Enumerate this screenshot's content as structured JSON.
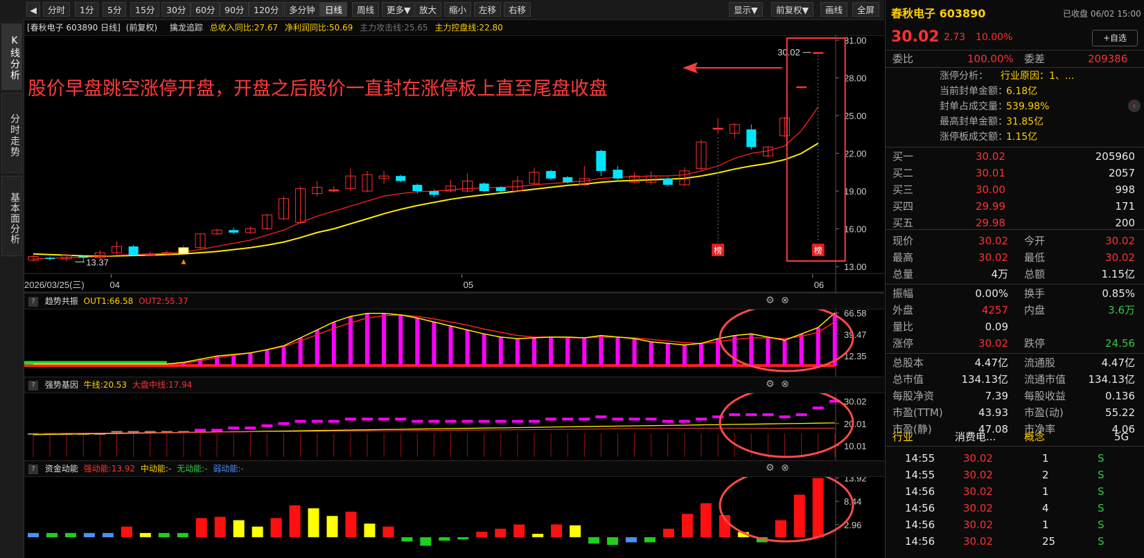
{
  "toolbar": {
    "nav_icon": "◀",
    "periods": [
      "分时",
      "1分",
      "5分",
      "15分",
      "30分",
      "60分",
      "90分",
      "120分",
      "多分钟",
      "日线",
      "周线",
      "更多▼"
    ],
    "actions": [
      "放大",
      "缩小",
      "左移",
      "右移"
    ],
    "right": [
      "显示▼",
      "前复权▼",
      "画线",
      "全屏"
    ]
  },
  "side_tabs": [
    "K线分析",
    "分时走势",
    "基本面分析"
  ],
  "main_header": {
    "title": "[春秋电子 603890 日线]",
    "fq": "(前复权)",
    "indicator": "擒龙追踪",
    "metric1": "总收入同比:27.67",
    "metric2": "净利润同比:50.69",
    "metric3": "主力攻击线:25.65",
    "metric4": "主力控盘线:22.80"
  },
  "annotation_text": "股价早盘跳空涨停开盘，开盘之后股价一直封在涨停板上直至尾盘收盘",
  "price_axis": [
    "31.00",
    "28.00",
    "25.00",
    "22.00",
    "19.00",
    "16.00",
    "13.00"
  ],
  "low_label": "13.37",
  "high_label": "30.02",
  "bang_label": "榜",
  "date_axis": {
    "start": "2026/03/25(三)",
    "m1": "04",
    "m2": "05",
    "m3": "06"
  },
  "panel1": {
    "name": "趋势共振",
    "out1": "OUT1:66.58",
    "out2": "OUT2:55.37",
    "axis": [
      "66.58",
      "39.47",
      "12.35"
    ]
  },
  "panel2": {
    "name": "强势基因",
    "l1": "牛线:20.53",
    "l2": "大盘中线:17.94",
    "axis": [
      "30.02",
      "20.01",
      "10.01"
    ]
  },
  "panel3": {
    "name": "资金动能",
    "l1": "强动能:13.92",
    "l2": "中动能:-",
    "l3": "无动能:-",
    "l4": "弱动能:-",
    "axis": [
      "13.92",
      "8.44",
      "2.96"
    ]
  },
  "colors": {
    "up": "#ff3030",
    "down": "#00e5ff",
    "ma1": "#ff2020",
    "ma2": "#ffee00",
    "magenta": "#ff00ff",
    "annot": "#ff3b3b"
  },
  "candles": [
    {
      "o": 13.5,
      "c": 13.8,
      "h": 13.9,
      "l": 13.4
    },
    {
      "o": 13.7,
      "c": 13.6,
      "h": 13.8,
      "l": 13.5
    },
    {
      "o": 13.6,
      "c": 13.9,
      "h": 14.0,
      "l": 13.4
    },
    {
      "o": 13.8,
      "c": 13.7,
      "h": 13.9,
      "l": 13.37
    },
    {
      "o": 13.7,
      "c": 14.1,
      "h": 14.3,
      "l": 13.6
    },
    {
      "o": 14.1,
      "c": 14.6,
      "h": 15.0,
      "l": 14.0
    },
    {
      "o": 14.6,
      "c": 13.9,
      "h": 14.7,
      "l": 13.8
    },
    {
      "o": 13.9,
      "c": 14.0,
      "h": 14.2,
      "l": 13.8
    },
    {
      "o": 14.0,
      "c": 14.1,
      "h": 14.3,
      "l": 13.9
    },
    {
      "o": 14.0,
      "c": 14.5,
      "h": 14.7,
      "l": 13.9
    },
    {
      "o": 14.5,
      "c": 15.6,
      "h": 15.6,
      "l": 14.4
    },
    {
      "o": 15.6,
      "c": 15.9,
      "h": 16.0,
      "l": 15.5
    },
    {
      "o": 15.9,
      "c": 15.7,
      "h": 16.1,
      "l": 15.6
    },
    {
      "o": 15.7,
      "c": 16.0,
      "h": 16.2,
      "l": 15.6
    },
    {
      "o": 16.0,
      "c": 17.1,
      "h": 17.2,
      "l": 15.9
    },
    {
      "o": 16.8,
      "c": 18.4,
      "h": 18.6,
      "l": 16.7
    },
    {
      "o": 16.5,
      "c": 19.2,
      "h": 19.4,
      "l": 16.4
    },
    {
      "o": 18.8,
      "c": 19.3,
      "h": 19.8,
      "l": 18.6
    },
    {
      "o": 19.0,
      "c": 19.1,
      "h": 19.4,
      "l": 18.9
    },
    {
      "o": 19.2,
      "c": 20.2,
      "h": 20.8,
      "l": 19.0
    },
    {
      "o": 19.0,
      "c": 20.3,
      "h": 20.6,
      "l": 18.9
    },
    {
      "o": 20.0,
      "c": 20.2,
      "h": 20.6,
      "l": 19.6
    },
    {
      "o": 20.2,
      "c": 19.8,
      "h": 20.3,
      "l": 19.7
    },
    {
      "o": 19.5,
      "c": 19.0,
      "h": 19.6,
      "l": 18.8
    },
    {
      "o": 19.0,
      "c": 18.7,
      "h": 19.1,
      "l": 18.5
    },
    {
      "o": 19.0,
      "c": 19.4,
      "h": 19.9,
      "l": 18.9
    },
    {
      "o": 19.0,
      "c": 19.8,
      "h": 20.4,
      "l": 18.9
    },
    {
      "o": 19.6,
      "c": 19.0,
      "h": 19.7,
      "l": 18.9
    },
    {
      "o": 19.3,
      "c": 19.0,
      "h": 19.4,
      "l": 18.9
    },
    {
      "o": 19.0,
      "c": 19.8,
      "h": 20.2,
      "l": 18.9
    },
    {
      "o": 19.6,
      "c": 20.5,
      "h": 20.8,
      "l": 19.5
    },
    {
      "o": 20.6,
      "c": 20.0,
      "h": 20.7,
      "l": 19.9
    },
    {
      "o": 20.1,
      "c": 19.7,
      "h": 20.2,
      "l": 19.6
    },
    {
      "o": 19.5,
      "c": 20.0,
      "h": 21.0,
      "l": 19.4
    },
    {
      "o": 22.2,
      "c": 20.6,
      "h": 22.3,
      "l": 20.2
    },
    {
      "o": 20.7,
      "c": 20.0,
      "h": 21.0,
      "l": 19.9
    },
    {
      "o": 19.7,
      "c": 20.2,
      "h": 20.5,
      "l": 19.6
    },
    {
      "o": 19.7,
      "c": 20.2,
      "h": 20.6,
      "l": 19.5
    },
    {
      "o": 20.0,
      "c": 19.5,
      "h": 20.1,
      "l": 19.4
    },
    {
      "o": 19.5,
      "c": 20.6,
      "h": 20.9,
      "l": 19.4
    },
    {
      "o": 20.8,
      "c": 22.9,
      "h": 23.1,
      "l": 20.6
    },
    {
      "o": 24.0,
      "c": 24.0,
      "h": 24.8,
      "l": 23.5
    },
    {
      "o": 23.6,
      "c": 24.3,
      "h": 24.4,
      "l": 23.2
    },
    {
      "o": 23.9,
      "c": 22.5,
      "h": 24.3,
      "l": 22.3
    },
    {
      "o": 21.8,
      "c": 22.5,
      "h": 22.6,
      "l": 21.7
    },
    {
      "o": 23.4,
      "c": 24.8,
      "h": 24.9,
      "l": 23.3
    },
    {
      "o": 27.3,
      "c": 27.3,
      "h": 27.3,
      "l": 27.3
    },
    {
      "o": 30.02,
      "c": 30.02,
      "h": 30.02,
      "l": 30.02
    }
  ],
  "ma1": [
    13.6,
    13.65,
    13.7,
    13.72,
    13.8,
    13.9,
    13.95,
    14.0,
    14.05,
    14.15,
    14.35,
    14.6,
    14.85,
    15.1,
    15.5,
    15.9,
    16.5,
    17.0,
    17.4,
    17.8,
    18.2,
    18.6,
    18.8,
    18.95,
    19.0,
    19.1,
    19.2,
    19.25,
    19.3,
    19.35,
    19.5,
    19.6,
    19.7,
    19.8,
    20.0,
    20.1,
    20.15,
    20.2,
    20.2,
    20.3,
    20.6,
    21.0,
    21.6,
    22.0,
    22.2,
    22.6,
    23.8,
    25.7
  ],
  "ma2": [
    14.0,
    13.95,
    13.9,
    13.85,
    13.82,
    13.85,
    13.88,
    13.9,
    13.95,
    14.0,
    14.1,
    14.2,
    14.35,
    14.5,
    14.7,
    14.95,
    15.3,
    15.7,
    16.0,
    16.4,
    16.8,
    17.2,
    17.55,
    17.85,
    18.1,
    18.35,
    18.55,
    18.7,
    18.85,
    19.0,
    19.15,
    19.3,
    19.45,
    19.55,
    19.7,
    19.8,
    19.85,
    19.9,
    19.95,
    20.0,
    20.2,
    20.45,
    20.75,
    21.0,
    21.2,
    21.5,
    22.0,
    22.8
  ],
  "p1_bars": [
    0,
    0,
    0,
    0,
    0,
    0,
    0,
    0,
    0,
    4,
    8,
    12,
    14,
    16,
    20,
    25,
    35,
    45,
    55,
    62,
    66,
    66,
    64,
    60,
    55,
    50,
    45,
    40,
    36,
    34,
    35,
    36,
    36,
    35,
    38,
    36,
    34,
    30,
    28,
    26,
    28,
    34,
    38,
    40,
    36,
    32,
    40,
    48,
    66.58
  ],
  "p1_red": [
    2,
    2,
    2,
    2,
    2,
    2,
    2,
    2,
    2,
    3,
    6,
    10,
    13,
    16,
    20,
    24,
    31,
    39,
    47,
    54,
    60,
    63,
    64,
    62,
    59,
    55,
    51,
    46,
    42,
    38,
    36,
    36,
    35,
    35,
    36,
    36,
    35,
    33,
    31,
    29,
    28,
    30,
    33,
    35,
    35,
    34,
    37,
    42,
    55.37
  ],
  "p1_yel": [
    2,
    2,
    2,
    2,
    2,
    2,
    2,
    2,
    2,
    4,
    8,
    12,
    14,
    16,
    20,
    25,
    35,
    45,
    55,
    62,
    66,
    66,
    64,
    60,
    55,
    50,
    45,
    40,
    36,
    34,
    35,
    36,
    36,
    35,
    38,
    36,
    34,
    30,
    28,
    26,
    28,
    34,
    38,
    40,
    36,
    32,
    40,
    48,
    66.58
  ],
  "p2_bars": [
    15,
    15,
    15,
    15,
    15,
    16,
    16,
    16,
    16,
    16,
    17,
    17,
    18,
    18,
    19,
    20,
    21,
    21,
    21,
    22,
    22,
    22,
    22,
    21,
    21,
    21,
    21,
    21,
    21,
    21,
    21,
    22,
    22,
    22,
    23,
    22,
    22,
    22,
    21,
    21,
    22,
    23,
    24,
    24,
    24,
    23,
    24,
    27,
    30.02
  ],
  "p3_vals": [
    {
      "v": 1.0,
      "t": "b"
    },
    {
      "v": 1.0,
      "t": "g"
    },
    {
      "v": 1.0,
      "t": "g"
    },
    {
      "v": 1.0,
      "t": "b"
    },
    {
      "v": 1.0,
      "t": "b"
    },
    {
      "v": 2.5,
      "t": "r"
    },
    {
      "v": 1.0,
      "t": "y"
    },
    {
      "v": 1.0,
      "t": "g"
    },
    {
      "v": 1.0,
      "t": "g"
    },
    {
      "v": 4.5,
      "t": "r"
    },
    {
      "v": 4.8,
      "t": "r"
    },
    {
      "v": 4.0,
      "t": "y"
    },
    {
      "v": 2.5,
      "t": "y"
    },
    {
      "v": 4.5,
      "t": "r"
    },
    {
      "v": 7.5,
      "t": "r"
    },
    {
      "v": 6.8,
      "t": "y"
    },
    {
      "v": 5.0,
      "t": "y"
    },
    {
      "v": 6.0,
      "t": "r"
    },
    {
      "v": 3.2,
      "t": "y"
    },
    {
      "v": 2.5,
      "t": "r"
    },
    {
      "v": -1.0,
      "t": "g"
    },
    {
      "v": -2.0,
      "t": "g"
    },
    {
      "v": -0.8,
      "t": "g"
    },
    {
      "v": -0.5,
      "t": "g"
    },
    {
      "v": 1.3,
      "t": "r"
    },
    {
      "v": 2.0,
      "t": "r"
    },
    {
      "v": 3.0,
      "t": "r"
    },
    {
      "v": 0.8,
      "t": "y"
    },
    {
      "v": 3.0,
      "t": "r"
    },
    {
      "v": 2.8,
      "t": "y"
    },
    {
      "v": -1.5,
      "t": "g"
    },
    {
      "v": -1.8,
      "t": "g"
    },
    {
      "v": -1.2,
      "t": "b"
    },
    {
      "v": -1.2,
      "t": "g"
    },
    {
      "v": 2.0,
      "t": "r"
    },
    {
      "v": 5.5,
      "t": "r"
    },
    {
      "v": 8.0,
      "t": "r"
    },
    {
      "v": 5.2,
      "t": "r"
    },
    {
      "v": 1.2,
      "t": "y"
    },
    {
      "v": -1.2,
      "t": "g"
    },
    {
      "v": 4.0,
      "t": "r"
    },
    {
      "v": 10.0,
      "t": "r"
    },
    {
      "v": 13.92,
      "t": "r"
    }
  ],
  "right": {
    "stock": "春秋电子 603890",
    "status": "已收盘 06/02 15:00",
    "price": "30.02",
    "change": "2.73",
    "pct": "10.00%",
    "watch": "+自选",
    "weibi_l": "委比",
    "weibi": "100.00%",
    "weicha_l": "委差",
    "weicha": "209386",
    "limit_title": "涨停分析：",
    "limit_reason": "行业原因：1、...",
    "seal_amt_l": "当前封单金额：",
    "seal_amt": "6.18亿",
    "seal_ratio_l": "封单占成交量：",
    "seal_ratio": "539.98%",
    "max_seal_l": "最高封单金额：",
    "max_seal": "31.85亿",
    "limit_vol_l": "涨停板成交额：",
    "limit_vol": "1.15亿",
    "buys": [
      {
        "l": "买一",
        "p": "30.02",
        "v": "205960"
      },
      {
        "l": "买二",
        "p": "30.01",
        "v": "2057"
      },
      {
        "l": "买三",
        "p": "30.00",
        "v": "998"
      },
      {
        "l": "买四",
        "p": "29.99",
        "v": "171"
      },
      {
        "l": "买五",
        "p": "29.98",
        "v": "200"
      }
    ],
    "stats": [
      {
        "a": "现价",
        "av": "30.02",
        "ac": "red",
        "b": "今开",
        "bv": "30.02",
        "bc": "red"
      },
      {
        "a": "最高",
        "av": "30.02",
        "ac": "red",
        "b": "最低",
        "bv": "30.02",
        "bc": "red"
      },
      {
        "a": "总量",
        "av": "4万",
        "ac": "white",
        "b": "总额",
        "bv": "1.15亿",
        "bc": "white"
      },
      {
        "a": "振幅",
        "av": "0.00%",
        "ac": "white",
        "b": "换手",
        "bv": "0.85%",
        "bc": "white"
      },
      {
        "a": "外盘",
        "av": "4257",
        "ac": "red",
        "b": "内盘",
        "bv": "3.6万",
        "bc": "green"
      },
      {
        "a": "量比",
        "av": "0.09",
        "ac": "white",
        "b": "",
        "bv": "",
        "bc": "white"
      },
      {
        "a": "涨停",
        "av": "30.02",
        "ac": "red",
        "b": "跌停",
        "bv": "24.56",
        "bc": "green"
      },
      {
        "a": "总股本",
        "av": "4.47亿",
        "ac": "white",
        "b": "流通股",
        "bv": "4.47亿",
        "bc": "white"
      },
      {
        "a": "总市值",
        "av": "134.13亿",
        "ac": "white",
        "b": "流通市值",
        "bv": "134.13亿",
        "bc": "white"
      },
      {
        "a": "每股净资",
        "av": "7.39",
        "ac": "white",
        "b": "每股收益",
        "bv": "0.136",
        "bc": "white"
      },
      {
        "a": "市盈(TTM)",
        "av": "43.93",
        "ac": "white",
        "b": "市盈(动)",
        "bv": "55.22",
        "bc": "white"
      },
      {
        "a": "市盈(静)",
        "av": "47.08",
        "ac": "white",
        "b": "市净率",
        "bv": "4.06",
        "bc": "white"
      }
    ],
    "industry_l": "行业",
    "industry": "消费电...",
    "concept_l": "概念",
    "concept": "5G",
    "ticks": [
      {
        "t": "14:55",
        "p": "30.02",
        "v": "1",
        "s": "S"
      },
      {
        "t": "14:55",
        "p": "30.02",
        "v": "2",
        "s": "S"
      },
      {
        "t": "14:56",
        "p": "30.02",
        "v": "1",
        "s": "S"
      },
      {
        "t": "14:56",
        "p": "30.02",
        "v": "4",
        "s": "S"
      },
      {
        "t": "14:56",
        "p": "30.02",
        "v": "1",
        "s": "S"
      },
      {
        "t": "14:56",
        "p": "30.02",
        "v": "25",
        "s": "S"
      }
    ]
  }
}
